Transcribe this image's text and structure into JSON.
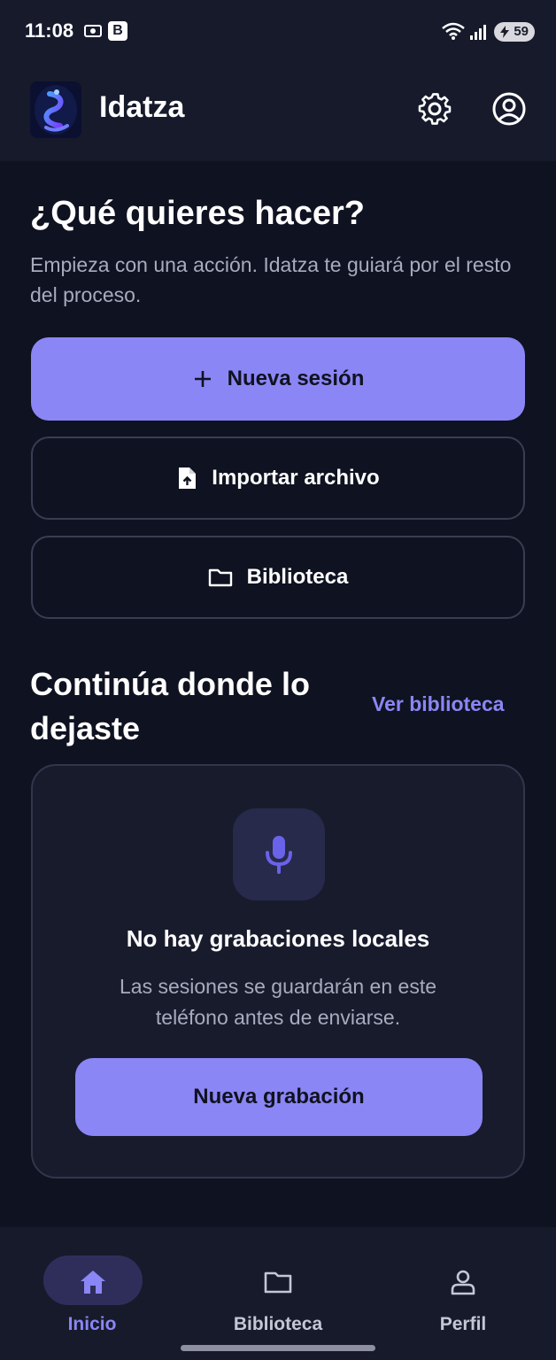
{
  "status_bar": {
    "time": "11:08",
    "b_badge": "B",
    "battery_level": "59"
  },
  "app_bar": {
    "title": "Idatza",
    "icons": [
      "app-logo",
      "gear-icon",
      "account-circle-icon"
    ]
  },
  "hero": {
    "heading": "¿Qué quieres hacer?",
    "subtitle": "Empieza con una acción. Idatza te guiará por el resto del proceso."
  },
  "actions": {
    "new_session": "Nueva sesión",
    "import_file": "Importar archivo",
    "library": "Biblioteca"
  },
  "recent": {
    "title": "Continúa donde lo dejaste",
    "see_library": "Ver biblioteca",
    "empty_title": "No hay grabaciones locales",
    "empty_text": "Las sesiones se guardarán en este teléfono antes de enviarse.",
    "new_recording": "Nueva grabación"
  },
  "bottom_nav": {
    "items": [
      {
        "label": "Inicio",
        "icon": "home-icon",
        "active": true
      },
      {
        "label": "Biblioteca",
        "icon": "folder-icon",
        "active": false
      },
      {
        "label": "Perfil",
        "icon": "person-icon",
        "active": false
      }
    ]
  },
  "colors": {
    "background": "#0f1220",
    "surface": "#171a2b",
    "accent": "#8b86f5",
    "muted_text": "#a7abbd"
  }
}
